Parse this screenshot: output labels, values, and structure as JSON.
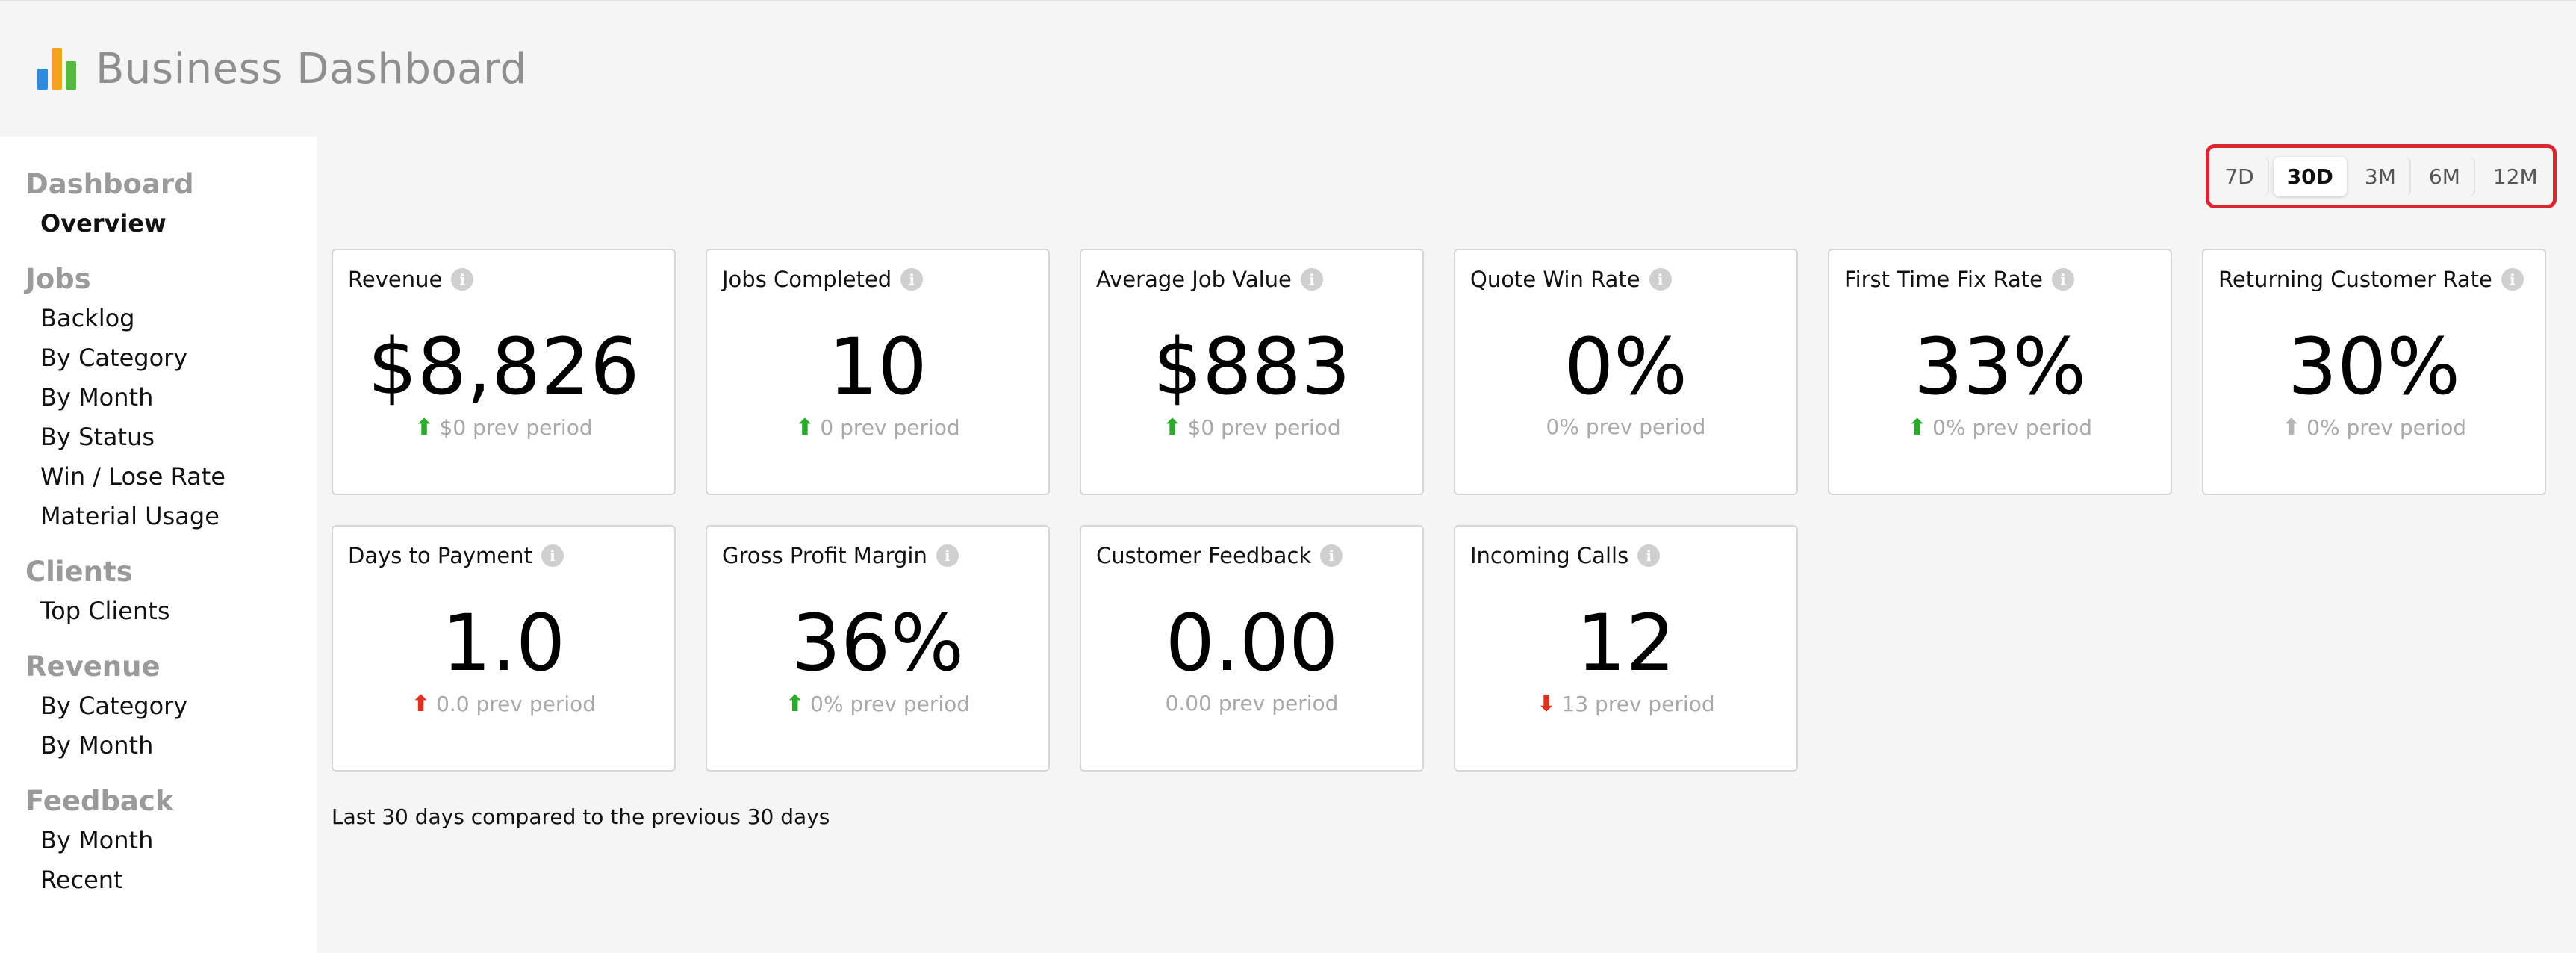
{
  "app": {
    "title": "Business Dashboard"
  },
  "colors": {
    "logo_bars": [
      "#2a8be0",
      "#f2a21e",
      "#55b83f"
    ],
    "accent_box": "#d9262f"
  },
  "sidebar": {
    "groups": [
      {
        "heading": "Dashboard",
        "items": [
          "Overview"
        ]
      },
      {
        "heading": "Jobs",
        "items": [
          "Backlog",
          "By Category",
          "By Month",
          "By Status",
          "Win / Lose Rate",
          "Material Usage"
        ]
      },
      {
        "heading": "Clients",
        "items": [
          "Top Clients"
        ]
      },
      {
        "heading": "Revenue",
        "items": [
          "By Category",
          "By Month"
        ]
      },
      {
        "heading": "Feedback",
        "items": [
          "By Month",
          "Recent"
        ]
      }
    ],
    "active_item": "Overview"
  },
  "range": {
    "options": [
      "7D",
      "30D",
      "3M",
      "6M",
      "12M"
    ],
    "selected": "30D"
  },
  "metrics": [
    {
      "title": "Revenue",
      "value": "$8,826",
      "prev": "$0 prev period",
      "trend": "up-green"
    },
    {
      "title": "Jobs Completed",
      "value": "10",
      "prev": "0 prev period",
      "trend": "up-green"
    },
    {
      "title": "Average Job Value",
      "value": "$883",
      "prev": "$0 prev period",
      "trend": "up-green"
    },
    {
      "title": "Quote Win Rate",
      "value": "0%",
      "prev": "0% prev period",
      "trend": "none"
    },
    {
      "title": "First Time Fix Rate",
      "value": "33%",
      "prev": "0% prev period",
      "trend": "up-green"
    },
    {
      "title": "Returning Customer Rate",
      "value": "30%",
      "prev": "0% prev period",
      "trend": "up-gray"
    },
    {
      "title": "Days to Payment",
      "value": "1.0",
      "prev": "0.0 prev period",
      "trend": "up-red"
    },
    {
      "title": "Gross Profit Margin",
      "value": "36%",
      "prev": "0% prev period",
      "trend": "up-green"
    },
    {
      "title": "Customer Feedback",
      "value": "0.00",
      "prev": "0.00 prev period",
      "trend": "none"
    },
    {
      "title": "Incoming Calls",
      "value": "12",
      "prev": "13 prev period",
      "trend": "down-red"
    }
  ],
  "footnote": "Last 30 days compared to the previous 30 days"
}
